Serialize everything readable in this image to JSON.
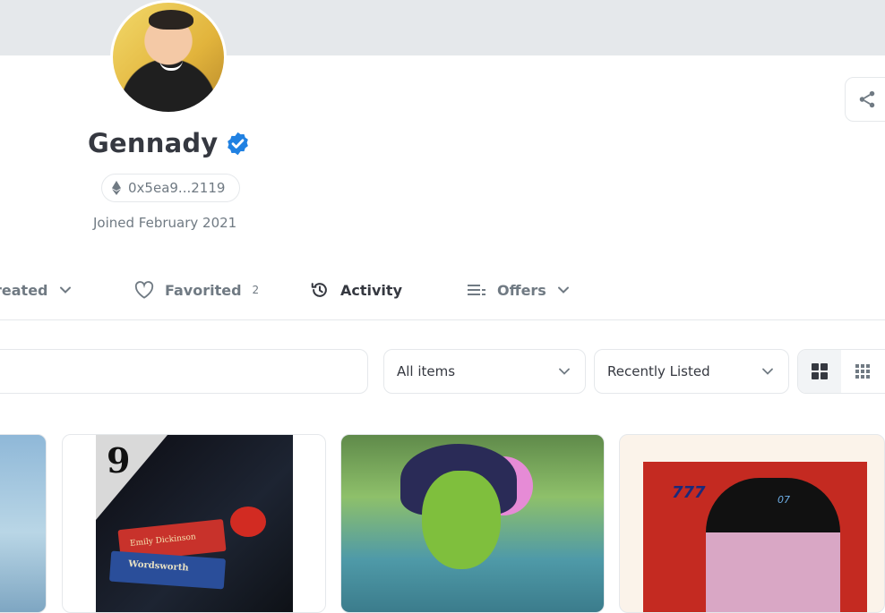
{
  "profile": {
    "name": "Gennady",
    "address": "0x5ea9...2119",
    "joined": "Joined February 2021",
    "verified": true
  },
  "tabs": [
    {
      "label": "Created",
      "visible_label": "reated",
      "has_dropdown": true,
      "icon": "chevron-down-icon"
    },
    {
      "label": "Favorited",
      "count": "2",
      "icon": "heart-icon"
    },
    {
      "label": "Activity",
      "active": true,
      "icon": "history-icon"
    },
    {
      "label": "Offers",
      "has_dropdown": true,
      "icon": "list-icon"
    }
  ],
  "filters": {
    "items_select": "All items",
    "sort_select": "Recently Listed"
  },
  "cards": [
    {
      "art_text": ""
    },
    {
      "art_text": "9",
      "book_text": [
        "Emily Dickinson",
        "Wordsworth"
      ]
    },
    {
      "art_text": ""
    },
    {
      "art_text": "777",
      "badge": "07"
    }
  ],
  "colors": {
    "verified": "#2081e2",
    "text_primary": "#353840",
    "text_secondary": "#707a83",
    "border": "#e5e8eb",
    "banner": "#e5e8eb"
  }
}
